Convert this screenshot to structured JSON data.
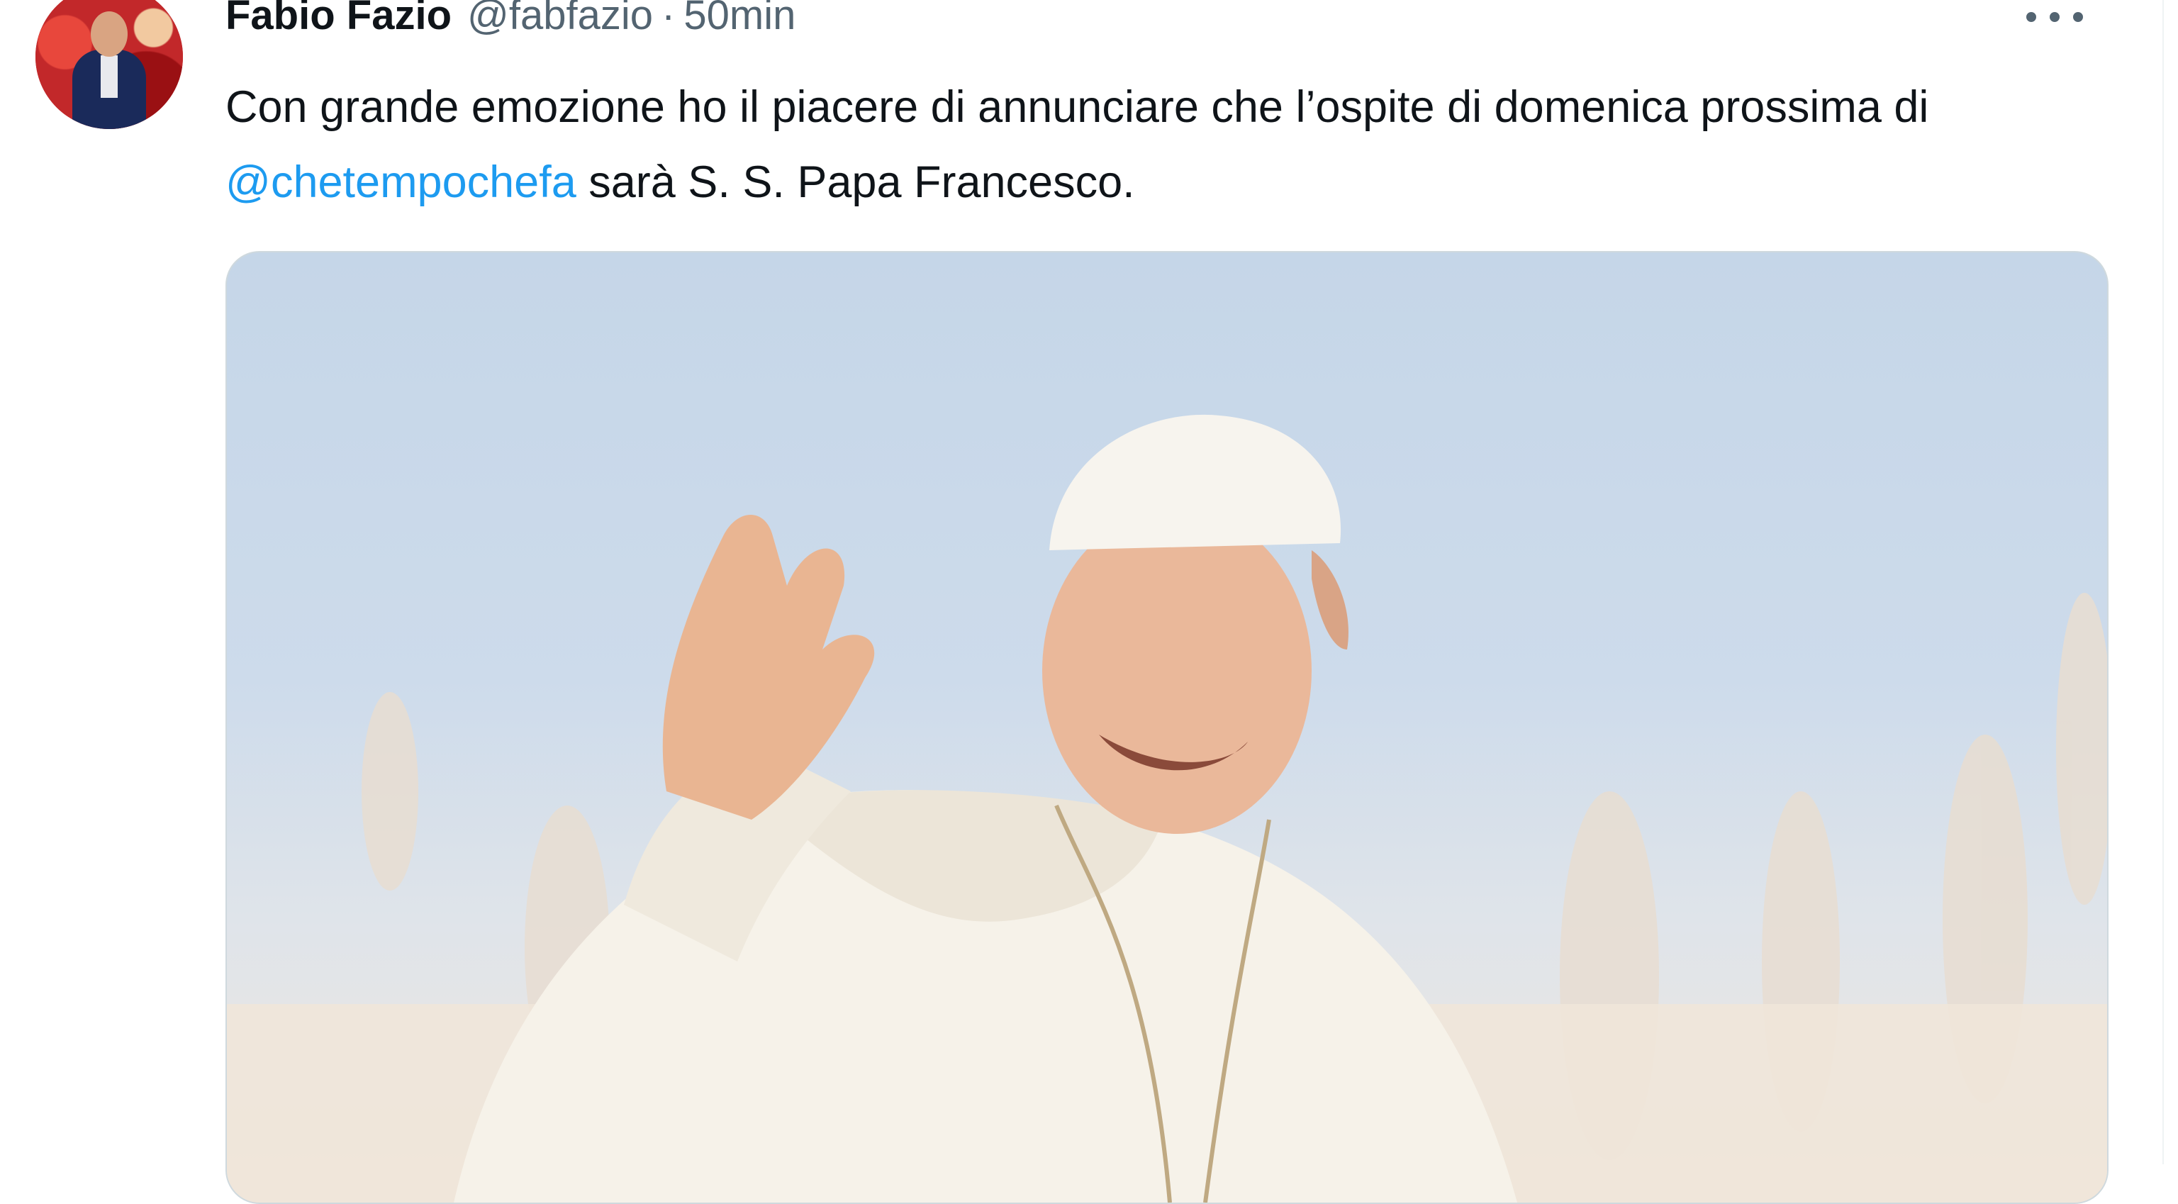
{
  "tweet": {
    "author_name": "Fabio Fazio",
    "handle": "@fabfazio",
    "separator": "·",
    "time": "50min",
    "text_before": "Con grande emozione ho il piacere di annunciare che l’ospite di domenica prossima di ",
    "mention": "@chetempochefa",
    "text_after": " sarà S. S. Papa Francesco.",
    "more_icon": "more-horizontal-icon",
    "media_description_icon": "photo"
  },
  "colors": {
    "text": "#0f1419",
    "secondary": "#536471",
    "link": "#1d9bf0",
    "border": "#cfd9de"
  }
}
